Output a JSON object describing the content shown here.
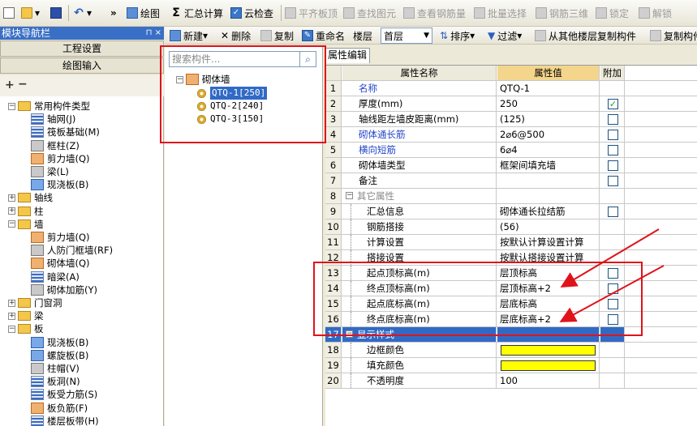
{
  "toolbar": {
    "draw": "绘图",
    "sum_calc": "汇总计算",
    "cloud_check": "云检查",
    "level_top": "平齐板顶",
    "find_element": "查找图元",
    "view_rebar": "查看钢筋量",
    "batch_select": "批量选择",
    "rebar_3d": "钢筋三维",
    "lock": "锁定",
    "unlock": "解锁",
    "more": "»"
  },
  "nav": {
    "title": "模块导航栏",
    "pin": "⊓ ×",
    "tab_project": "工程设置",
    "tab_draw": "绘图输入",
    "tree": [
      {
        "label": "常用构件类型",
        "level": 0,
        "exp": "−",
        "icon": "folder"
      },
      {
        "label": "轴网(J)",
        "level": 1,
        "icon": "a"
      },
      {
        "label": "筏板基础(M)",
        "level": 1,
        "icon": "a"
      },
      {
        "label": "框柱(Z)",
        "level": 1,
        "icon": "c"
      },
      {
        "label": "剪力墙(Q)",
        "level": 1,
        "icon": "b"
      },
      {
        "label": "梁(L)",
        "level": 1,
        "icon": "c"
      },
      {
        "label": "现浇板(B)",
        "level": 1,
        "icon": "d"
      },
      {
        "label": "轴线",
        "level": 0,
        "exp": "+",
        "icon": "folder"
      },
      {
        "label": "柱",
        "level": 0,
        "exp": "+",
        "icon": "folder"
      },
      {
        "label": "墙",
        "level": 0,
        "exp": "−",
        "icon": "folder"
      },
      {
        "label": "剪力墙(Q)",
        "level": 1,
        "icon": "b"
      },
      {
        "label": "人防门框墙(RF)",
        "level": 1,
        "icon": "c"
      },
      {
        "label": "砌体墙(Q)",
        "level": 1,
        "icon": "b"
      },
      {
        "label": "暗梁(A)",
        "level": 1,
        "icon": "a"
      },
      {
        "label": "砌体加筋(Y)",
        "level": 1,
        "icon": "c"
      },
      {
        "label": "门窗洞",
        "level": 0,
        "exp": "+",
        "icon": "folder"
      },
      {
        "label": "梁",
        "level": 0,
        "exp": "+",
        "icon": "folder"
      },
      {
        "label": "板",
        "level": 0,
        "exp": "−",
        "icon": "folder"
      },
      {
        "label": "现浇板(B)",
        "level": 1,
        "icon": "d"
      },
      {
        "label": "螺旋板(B)",
        "level": 1,
        "icon": "d"
      },
      {
        "label": "柱帽(V)",
        "level": 1,
        "icon": "c"
      },
      {
        "label": "板洞(N)",
        "level": 1,
        "icon": "a"
      },
      {
        "label": "板受力筋(S)",
        "level": 1,
        "icon": "a"
      },
      {
        "label": "板负筋(F)",
        "level": 1,
        "icon": "b"
      },
      {
        "label": "楼层板带(H)",
        "level": 1,
        "icon": "a"
      }
    ]
  },
  "midbar": {
    "new": "新建",
    "delete": "删除",
    "copy": "复制",
    "rename": "重命名",
    "floor_label": "楼层",
    "floor_value": "首层",
    "sort": "排序",
    "filter": "过滤",
    "copy_from_floor": "从其他楼层复制构件",
    "copy_to": "复制构件"
  },
  "component_list": {
    "search_placeholder": "搜索构件...",
    "root": "砌体墙",
    "items": [
      "QTQ-1[250]",
      "QTQ-2[240]",
      "QTQ-3[150]"
    ],
    "selected_index": 0
  },
  "props": {
    "tab": "属性编辑",
    "headers": {
      "name": "属性名称",
      "value": "属性值",
      "extra": "附加"
    },
    "rows": [
      {
        "n": "1",
        "name": "名称",
        "value": "QTQ-1",
        "blue": true,
        "check": null
      },
      {
        "n": "2",
        "name": "厚度(mm)",
        "value": "250",
        "check": true
      },
      {
        "n": "3",
        "name": "轴线距左墙皮距离(mm)",
        "value": "(125)",
        "check": false
      },
      {
        "n": "4",
        "name": "砌体通长筋",
        "value": "2⌀6@500",
        "blue": true,
        "check": false
      },
      {
        "n": "5",
        "name": "横向短筋",
        "value": "6⌀4",
        "blue": true,
        "check": false
      },
      {
        "n": "6",
        "name": "砌体墙类型",
        "value": "框架间填充墙",
        "check": false
      },
      {
        "n": "7",
        "name": "备注",
        "value": "",
        "check": false
      },
      {
        "n": "8",
        "name": "其它属性",
        "value": "",
        "group": true
      },
      {
        "n": "9",
        "name": "汇总信息",
        "value": "砌体通长拉结筋",
        "child": true,
        "check": false
      },
      {
        "n": "10",
        "name": "钢筋搭接",
        "value": "(56)",
        "child": true
      },
      {
        "n": "11",
        "name": "计算设置",
        "value": "按默认计算设置计算",
        "child": true
      },
      {
        "n": "12",
        "name": "搭接设置",
        "value": "按默认搭接设置计算",
        "child": true
      },
      {
        "n": "13",
        "name": "起点顶标高(m)",
        "value": "层顶标高",
        "child": true,
        "check": false
      },
      {
        "n": "14",
        "name": "终点顶标高(m)",
        "value": "层顶标高+2",
        "child": true,
        "check": false
      },
      {
        "n": "15",
        "name": "起点底标高(m)",
        "value": "层底标高",
        "child": true,
        "check": false
      },
      {
        "n": "16",
        "name": "终点底标高(m)",
        "value": "层底标高+2",
        "child": true,
        "check": false
      },
      {
        "n": "17",
        "name": "显示样式",
        "value": "",
        "group": true,
        "selected": true
      },
      {
        "n": "18",
        "name": "边框颜色",
        "value": "",
        "child": true,
        "color": "#ffff00"
      },
      {
        "n": "19",
        "name": "填充颜色",
        "value": "",
        "child": true,
        "color": "#ffff00"
      },
      {
        "n": "20",
        "name": "不透明度",
        "value": "100",
        "child": true
      }
    ]
  },
  "colors": {
    "annotation_red": "#e0131a",
    "selection_blue": "#316ac5",
    "header_value": "#f4d58c"
  }
}
